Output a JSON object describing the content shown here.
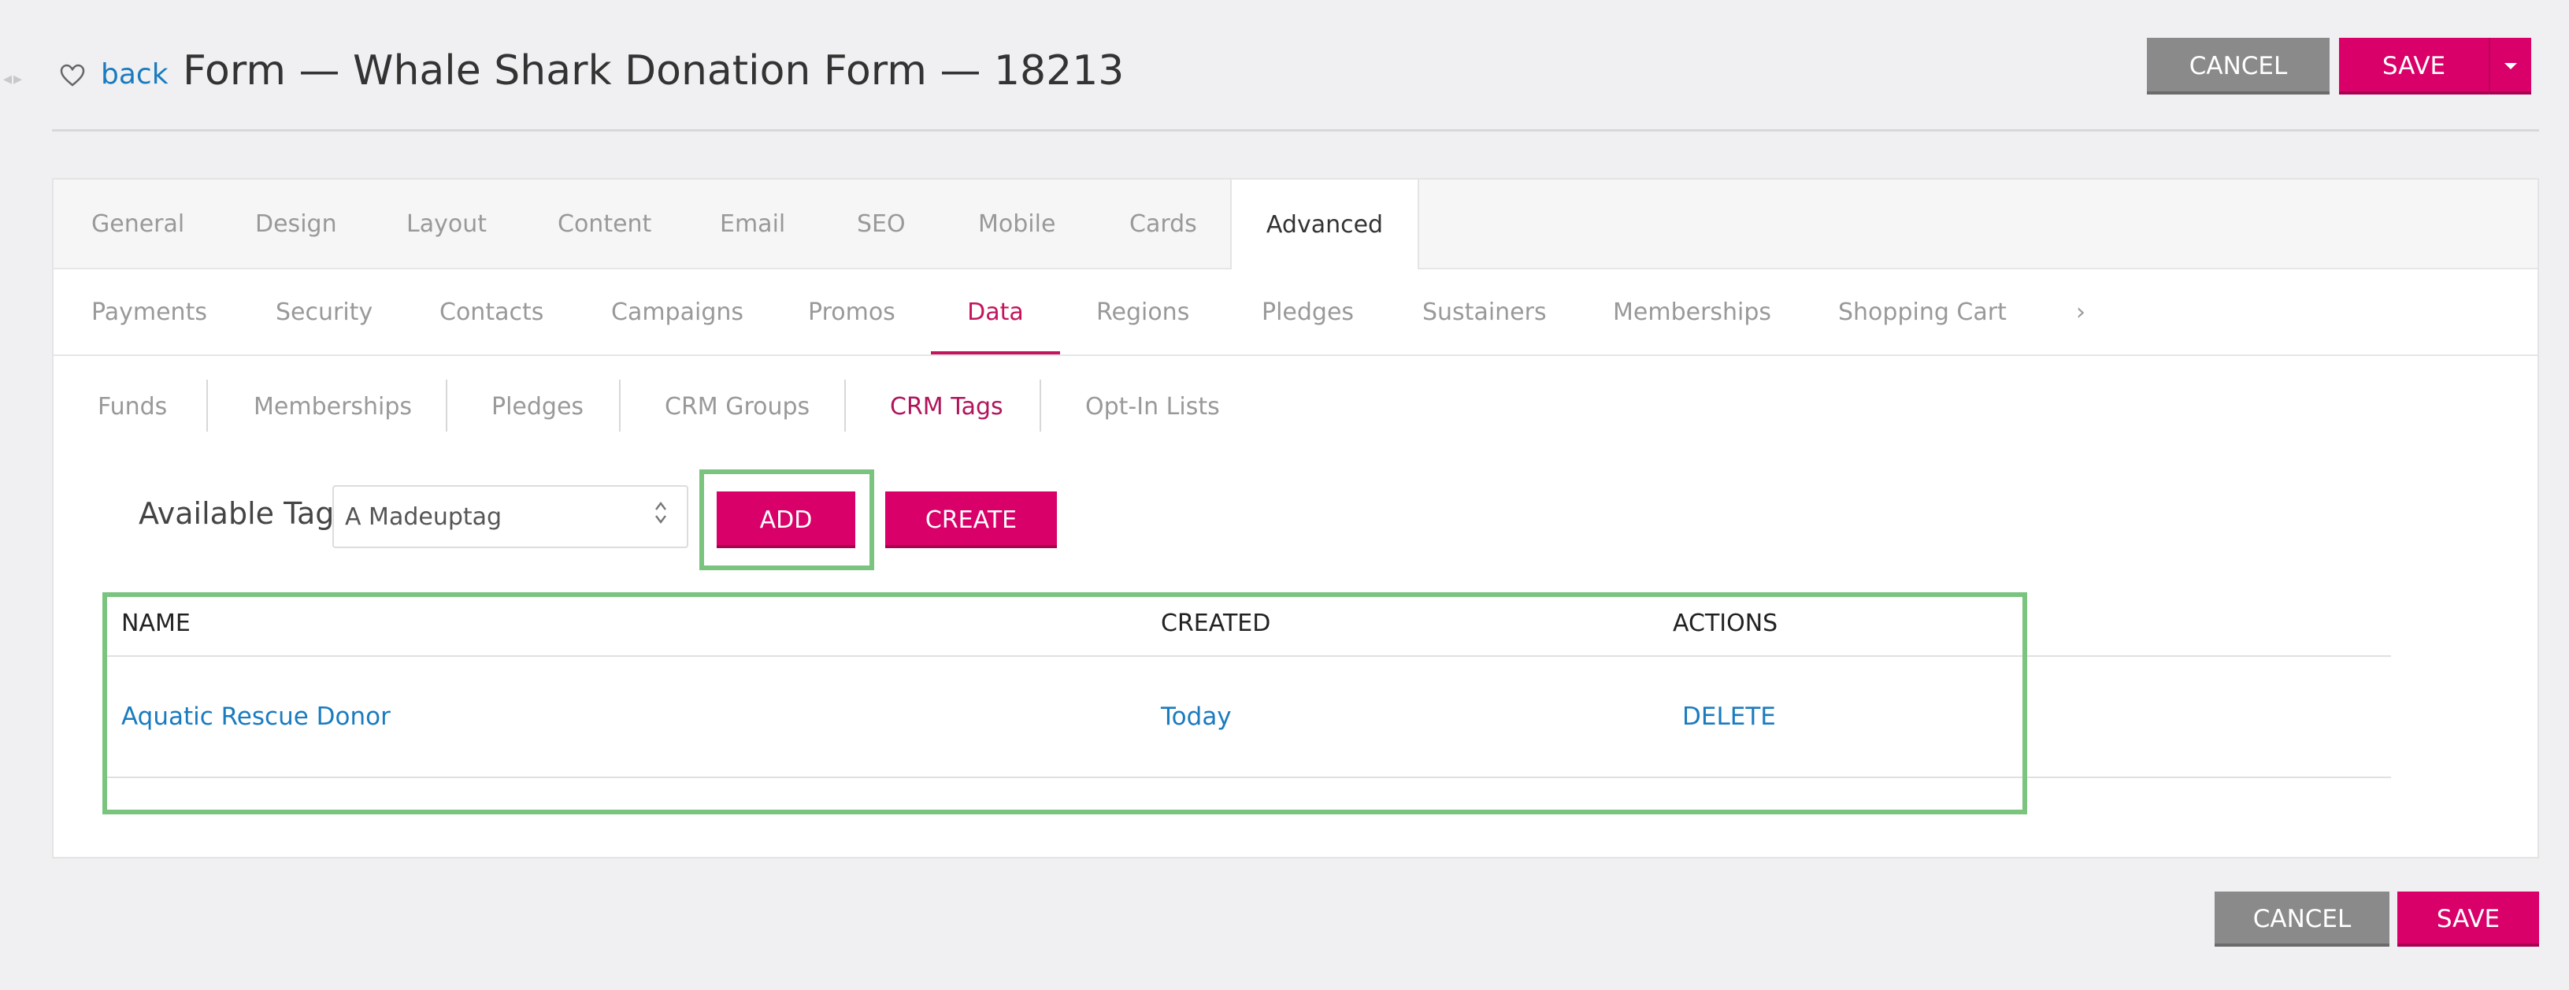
{
  "header": {
    "back_label": "back",
    "title": "Form — Whale Shark Donation Form — 18213",
    "cancel_label": "CANCEL",
    "save_label": "SAVE",
    "save_menu_icon": "caret-down-icon"
  },
  "primary_tabs": [
    {
      "label": "General"
    },
    {
      "label": "Design"
    },
    {
      "label": "Layout"
    },
    {
      "label": "Content"
    },
    {
      "label": "Email"
    },
    {
      "label": "SEO"
    },
    {
      "label": "Mobile"
    },
    {
      "label": "Cards"
    },
    {
      "label": "Advanced",
      "active": true
    }
  ],
  "secondary_tabs": [
    {
      "label": "Payments"
    },
    {
      "label": "Security"
    },
    {
      "label": "Contacts"
    },
    {
      "label": "Campaigns"
    },
    {
      "label": "Promos"
    },
    {
      "label": "Data",
      "active": true
    },
    {
      "label": "Regions"
    },
    {
      "label": "Pledges"
    },
    {
      "label": "Sustainers"
    },
    {
      "label": "Memberships"
    },
    {
      "label": "Shopping Cart"
    },
    {
      "label": "›"
    }
  ],
  "tertiary_tabs": [
    {
      "label": "Funds"
    },
    {
      "label": "Memberships"
    },
    {
      "label": "Pledges"
    },
    {
      "label": "CRM Groups"
    },
    {
      "label": "CRM Tags",
      "active": true
    },
    {
      "label": "Opt-In Lists"
    }
  ],
  "tags": {
    "available_label": "Available Tags",
    "selected_tag": "A Madeuptag",
    "add_label": "ADD",
    "create_label": "CREATE"
  },
  "table": {
    "columns": [
      "NAME",
      "CREATED",
      "ACTIONS"
    ],
    "rows": [
      {
        "name": "Aquatic Rescue Donor",
        "created": "Today",
        "action": "DELETE"
      }
    ]
  },
  "footer": {
    "cancel_label": "CANCEL",
    "save_label": "SAVE"
  },
  "colors": {
    "accent": "#d90069",
    "link": "#1a7bbf",
    "highlight": "#7bc47f",
    "grey_button": "#8a8a8a"
  }
}
